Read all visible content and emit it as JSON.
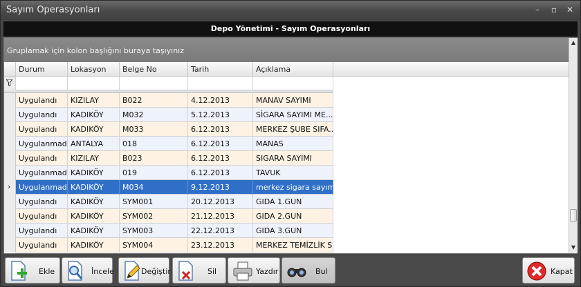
{
  "window": {
    "title": "Sayım Operasyonları"
  },
  "header": {
    "title": "Depo Yönetimi - Sayım Operasyonları"
  },
  "grid": {
    "group_panel_text": "Gruplamak için kolon başlığını buraya taşıyınız",
    "columns": [
      "Durum",
      "Lokasyon",
      "Belge No",
      "Tarih",
      "Açıklama"
    ],
    "rows": [
      {
        "durum": "Uygulandı",
        "lokasyon": "KIZILAY",
        "belge": "B022",
        "tarih": "4.12.2013",
        "aciklama": "MANAV SAYIMI"
      },
      {
        "durum": "Uygulandı",
        "lokasyon": "KADIKÖY",
        "belge": "M032",
        "tarih": "5.12.2013",
        "aciklama": "SİGARA SAYIMI ME..."
      },
      {
        "durum": "Uygulandı",
        "lokasyon": "KADIKÖY",
        "belge": "M033",
        "tarih": "6.12.2013",
        "aciklama": "MERKEZ ŞUBE SIFA..."
      },
      {
        "durum": "Uygulanmadı",
        "lokasyon": "ANTALYA",
        "belge": "018",
        "tarih": "6.12.2013",
        "aciklama": "MANAS"
      },
      {
        "durum": "Uygulandı",
        "lokasyon": "KIZILAY",
        "belge": "B023",
        "tarih": "6.12.2013",
        "aciklama": "SIGARA SAYIMI"
      },
      {
        "durum": "Uygulanmadı",
        "lokasyon": "KADIKÖY",
        "belge": "019",
        "tarih": "6.12.2013",
        "aciklama": "TAVUK"
      },
      {
        "durum": "Uygulanmadı",
        "lokasyon": "KADIKÖY",
        "belge": "M034",
        "tarih": "9.12.2013",
        "aciklama": "merkez sigara sayımı",
        "selected": true
      },
      {
        "durum": "Uygulandı",
        "lokasyon": "KADIKÖY",
        "belge": "SYM001",
        "tarih": "20.12.2013",
        "aciklama": "GIDA 1.GUN"
      },
      {
        "durum": "Uygulandı",
        "lokasyon": "KADIKÖY",
        "belge": "SYM002",
        "tarih": "21.12.2013",
        "aciklama": "GIDA 2.GUN"
      },
      {
        "durum": "Uygulandı",
        "lokasyon": "KADIKÖY",
        "belge": "SYM003",
        "tarih": "22.12.2013",
        "aciklama": "GIDA 3.GUN"
      },
      {
        "durum": "Uygulandı",
        "lokasyon": "KADIKÖY",
        "belge": "SYM004",
        "tarih": "23.12.2013",
        "aciklama": "MERKEZ TEMİZLİK S..."
      }
    ]
  },
  "toolbar": {
    "ekle": "Ekle",
    "incele": "İncele",
    "degistir": "Değiştir",
    "sil": "Sil",
    "yazdir": "Yazdır",
    "bul": "Bul",
    "kapat": "Kapat"
  },
  "icons": {
    "ekle": "document-add-icon",
    "incele": "magnifier-icon",
    "degistir": "pencil-edit-icon",
    "sil": "document-delete-icon",
    "yazdir": "printer-icon",
    "bul": "binoculars-icon",
    "kapat": "close-circle-icon"
  },
  "colors": {
    "selected_row": "#2f6fc8",
    "row_even": "#fdf2e3",
    "row_odd": "#eef2fb"
  }
}
